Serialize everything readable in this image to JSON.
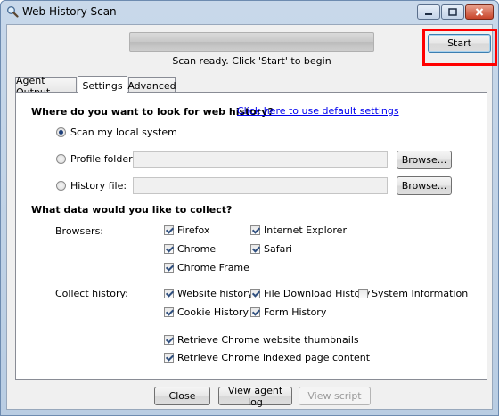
{
  "window": {
    "title": "Web History Scan"
  },
  "toolbar": {
    "start_label": "Start",
    "status": "Scan ready.  Click 'Start' to begin",
    "progress_fraction": 0
  },
  "tabs": [
    {
      "label": "Agent Output",
      "active": false
    },
    {
      "label": "Settings",
      "active": true
    },
    {
      "label": "Advanced",
      "active": false
    }
  ],
  "settings": {
    "location_heading": "Where do you want to look for web history?",
    "default_link": "Click here to use default settings",
    "radio_local": "Scan my local system",
    "radio_profile": "Profile folder:",
    "radio_history": "History file:",
    "profile_value": "",
    "history_value": "",
    "browse_label": "Browse...",
    "collect_heading": "What data would you like to collect?",
    "browsers_label": "Browsers:",
    "browsers": [
      {
        "label": "Firefox",
        "checked": true
      },
      {
        "label": "Internet Explorer",
        "checked": true
      },
      {
        "label": "Chrome",
        "checked": true
      },
      {
        "label": "Safari",
        "checked": true
      },
      {
        "label": "Chrome Frame",
        "checked": true
      }
    ],
    "collect_label": "Collect history:",
    "collect": [
      {
        "label": "Website history",
        "checked": true
      },
      {
        "label": "File Download History",
        "checked": true
      },
      {
        "label": "System Information",
        "checked": false
      },
      {
        "label": "Cookie History",
        "checked": true
      },
      {
        "label": "Form History",
        "checked": true
      }
    ],
    "extras": [
      {
        "label": "Retrieve Chrome website thumbnails",
        "checked": true
      },
      {
        "label": "Retrieve Chrome indexed page content",
        "checked": true
      }
    ]
  },
  "footer": {
    "close_label": "Close",
    "view_log_label": "View agent log",
    "view_script_label": "View script"
  }
}
